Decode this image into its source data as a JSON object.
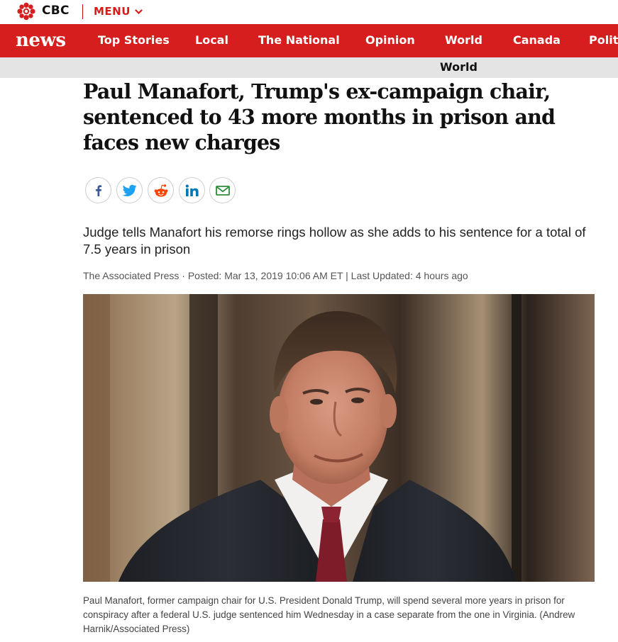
{
  "brand": {
    "name": "CBC",
    "menu_label": "MENU",
    "news_logo": "news"
  },
  "nav": {
    "items": [
      {
        "label": "Top Stories"
      },
      {
        "label": "Local"
      },
      {
        "label": "The National"
      },
      {
        "label": "Opinion"
      },
      {
        "label": "World"
      },
      {
        "label": "Canada"
      },
      {
        "label": "Politi"
      }
    ]
  },
  "section": {
    "label": "World"
  },
  "article": {
    "headline": "Paul Manafort, Trump's ex-campaign chair, sentenced to 43 more months in prison and faces new charges",
    "deck": "Judge tells Manafort his remorse rings hollow as she adds to his sentence for a total of 7.5 years in prison",
    "byline": "The Associated Press · Posted: Mar 13, 2019 10:06 AM ET | Last Updated: 4 hours ago",
    "caption": "Paul Manafort, former campaign chair for U.S. President Donald Trump, will spend several more years in prison for conspiracy after a federal U.S. judge sentenced him Wednesday in a case separate from the one in Virginia. (Andrew Harnik/Associated Press)"
  },
  "share": {
    "icons": [
      "facebook-icon",
      "twitter-icon",
      "reddit-icon",
      "linkedin-icon",
      "email-icon"
    ]
  },
  "colors": {
    "brand_red": "#d71e1e",
    "section_gray": "#e4e4e4",
    "facebook": "#3b5998",
    "twitter": "#1da1f2",
    "reddit": "#ff4500",
    "linkedin": "#0077b5",
    "email": "#2e8b3c"
  }
}
